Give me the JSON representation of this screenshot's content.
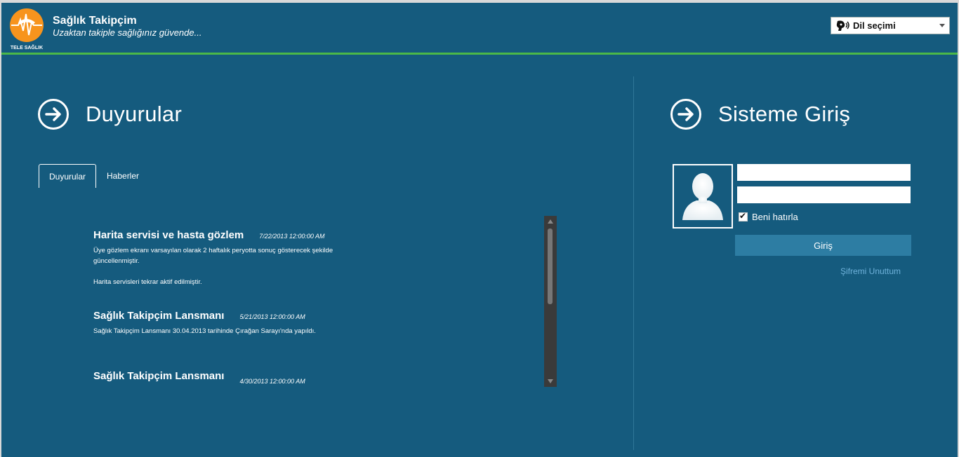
{
  "header": {
    "brand_title": "Sağlık Takipçim",
    "brand_tagline": "Uzaktan takiple sağlığınız güvende...",
    "logo_text": "TELE SAĞLIK",
    "language_select": {
      "selected": "Dil seçimi"
    }
  },
  "announcements": {
    "title": "Duyurular",
    "tabs": [
      {
        "label": "Duyurular",
        "active": true
      },
      {
        "label": "Haberler",
        "active": false
      }
    ],
    "items": [
      {
        "title": "Harita servisi ve hasta gözlem",
        "date": "7/22/2013 12:00:00 AM",
        "body_1": "Üye gözlem ekranı varsayılan olarak 2 haftalık peryotta sonuç gösterecek şekilde güncellenmiştir.",
        "body_2": "Harita servisleri tekrar aktif edilmiştir."
      },
      {
        "title": "Sağlık Takipçim Lansmanı",
        "date": "5/21/2013 12:00:00 AM",
        "body_1": "Sağlık Takipçim Lansmanı 30.04.2013 tarihinde Çırağan Sarayı'nda yapıldı."
      },
      {
        "title": "Sağlık Takipçim Lansmanı",
        "date": "4/30/2013 12:00:00 AM"
      }
    ]
  },
  "login": {
    "title": "Sisteme Giriş",
    "username_value": "",
    "password_value": "",
    "remember_label": "Beni hatırla",
    "remember_checked": true,
    "submit_label": "Giriş",
    "forgot_label": "Şifremi Unuttum"
  },
  "colors": {
    "background": "#155b7e",
    "accent_green": "#4cb848",
    "logo_orange": "#f7941d",
    "button": "#2d7da3",
    "link": "#6fb2db"
  }
}
